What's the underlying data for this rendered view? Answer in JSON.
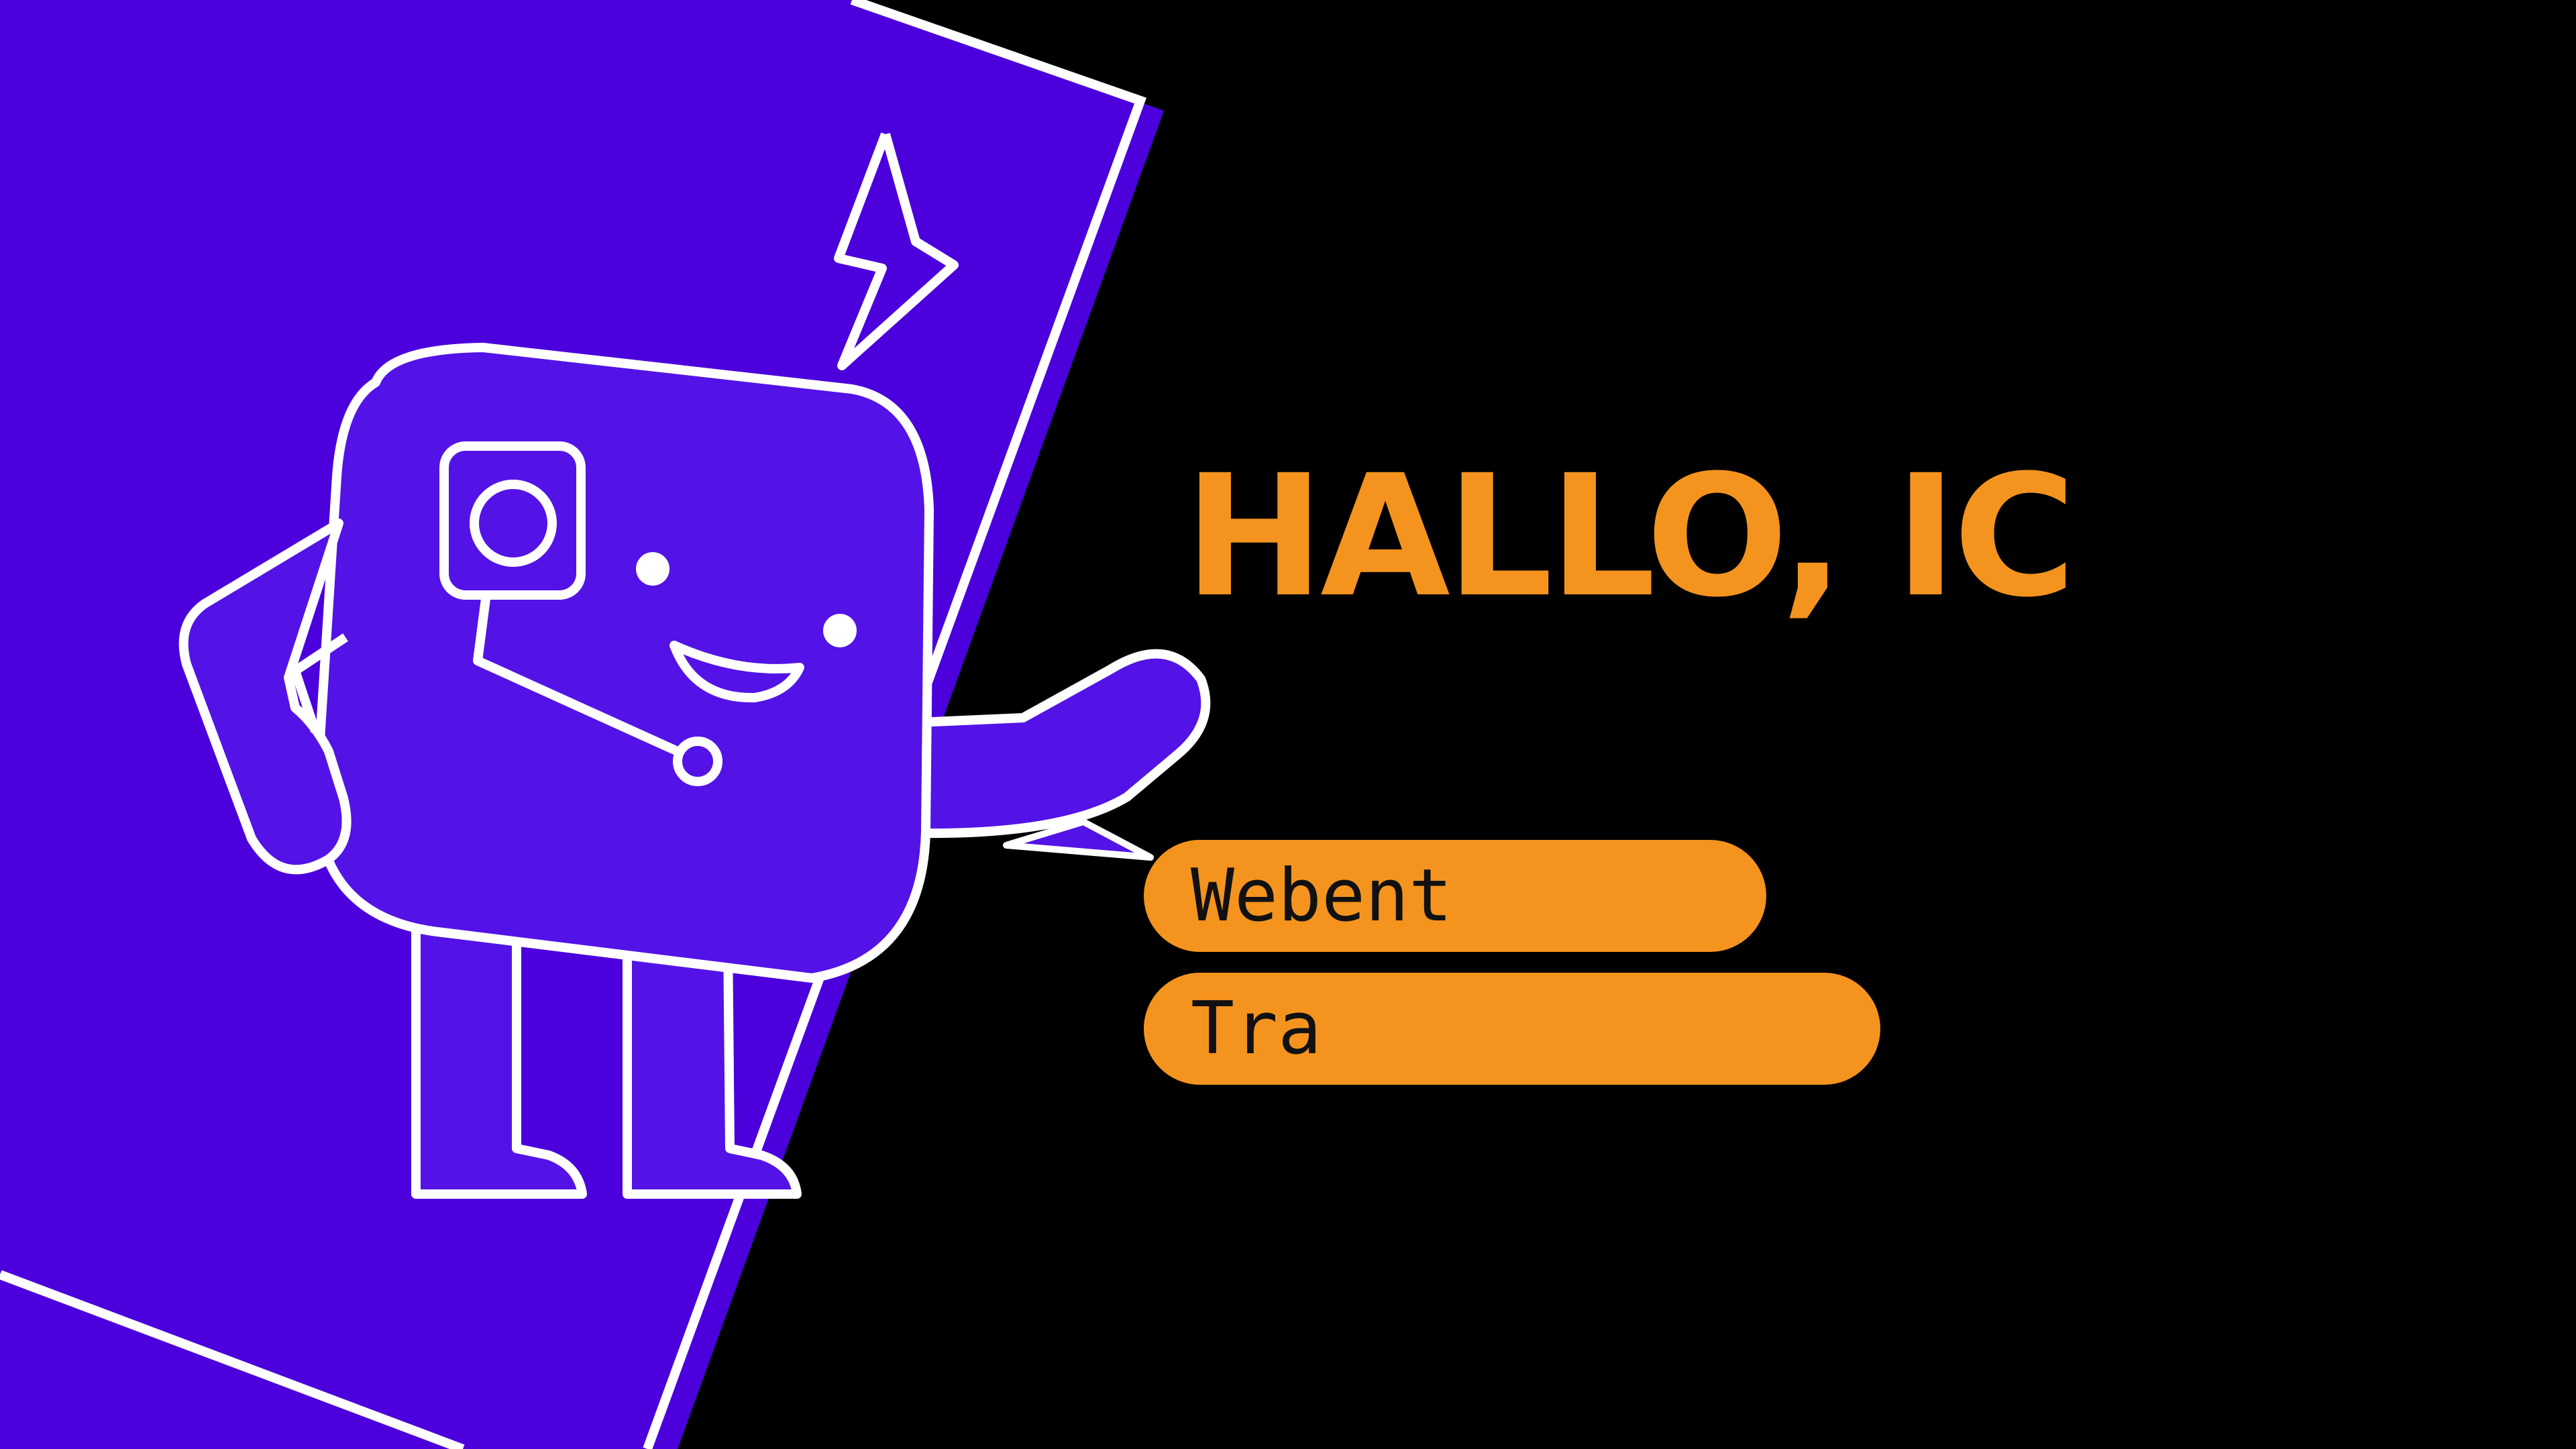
{
  "headline": "HALLO, IC",
  "pills": [
    {
      "label": "Webent"
    },
    {
      "label": "Tra"
    }
  ],
  "illustration": {
    "subject": "robot-mascot",
    "icons": [
      "lightning-bolt-icon",
      "camera-lens-icon"
    ]
  },
  "colors": {
    "background": "#000000",
    "panel": "#4b00dc",
    "mascot_fill": "#5313e6",
    "outline": "#ffffff",
    "accent": "#f4941f",
    "pill_text": "#111111"
  }
}
